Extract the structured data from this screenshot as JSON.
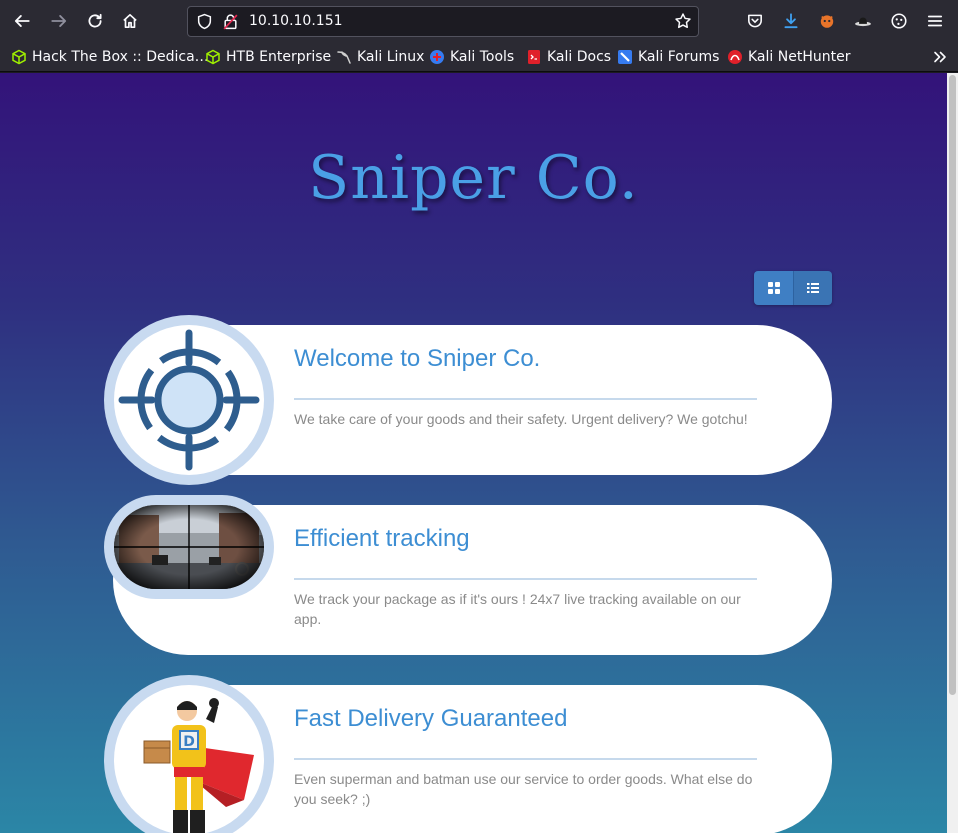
{
  "browser": {
    "url": "10.10.10.151",
    "bookmarks": [
      {
        "label": "Hack The Box :: Dedica…",
        "icon": "htb-cube-icon",
        "color": "#9fef00"
      },
      {
        "label": "HTB Enterprise",
        "icon": "htb-cube-icon",
        "color": "#9fef00"
      },
      {
        "label": "Kali Linux",
        "icon": "kali-dragon-icon",
        "color": "#cfcfcf"
      },
      {
        "label": "Kali Tools",
        "icon": "kali-tools-icon",
        "color": "#367bf0"
      },
      {
        "label": "Kali Docs",
        "icon": "kali-docs-icon",
        "color": "#e0202a"
      },
      {
        "label": "Kali Forums",
        "icon": "kali-forums-icon",
        "color": "#367bf0"
      },
      {
        "label": "Kali NetHunter",
        "icon": "nethunter-icon",
        "color": "#e0202a"
      }
    ]
  },
  "site": {
    "title": "Sniper Co."
  },
  "cards": [
    {
      "heading": "Welcome to Sniper Co.",
      "body": "We take care of your goods and their safety. Urgent delivery? We gotchu!"
    },
    {
      "heading": "Efficient tracking",
      "body": "We track your package as if it's ours ! 24x7 live tracking available on our app."
    },
    {
      "heading": "Fast Delivery Guaranteed",
      "body": "Even superman and batman use our service to order goods. What else do you seek? ;)"
    }
  ],
  "colors": {
    "accent": "#3d8ed3",
    "title": "#4aa0e6",
    "toggle": "#3f7fc4"
  }
}
